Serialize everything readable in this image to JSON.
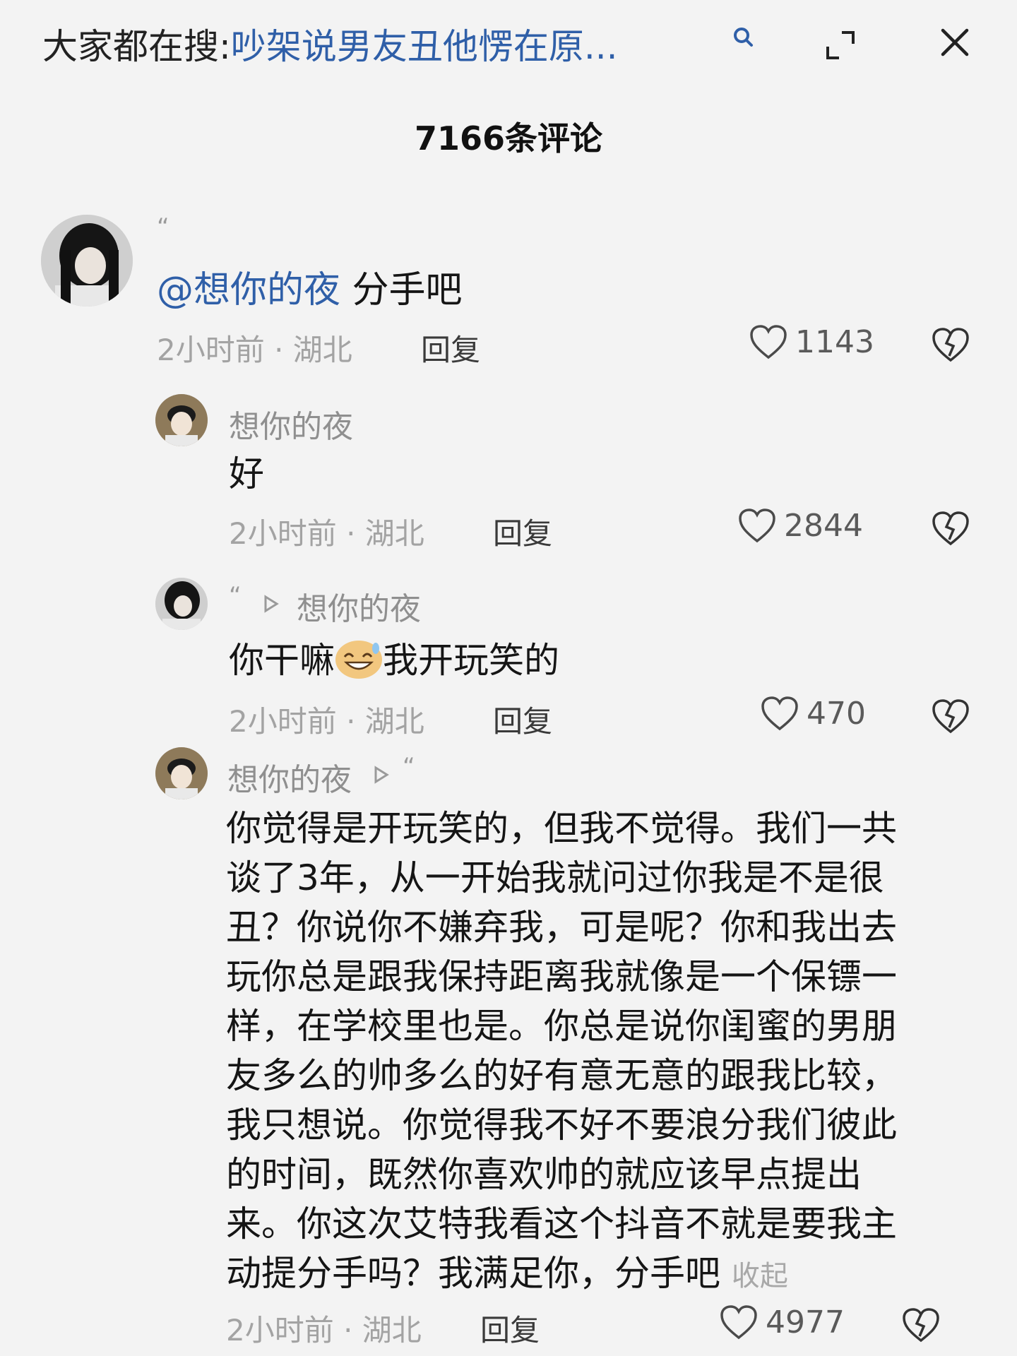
{
  "header": {
    "search_prefix": "大家都在搜:",
    "search_query": "吵架说男友丑他愣在原...",
    "icons": [
      "search-icon",
      "expand-icon",
      "close-icon"
    ]
  },
  "title": "7166条评论",
  "comments": [
    {
      "quote_mark": "“",
      "mention": "@想你的夜",
      "text": " 分手吧",
      "time": "2小时前",
      "location": "湖北",
      "reply_label": "回复",
      "likes": "1143"
    },
    {
      "username": "想你的夜",
      "text": "好",
      "time": "2小时前",
      "location": "湖北",
      "reply_label": "回复",
      "likes": "2844"
    },
    {
      "quote_mark": "“",
      "reply_to": "想你的夜",
      "text_before_emoji": "你干嘛",
      "emoji": "sweat-smile-emoji",
      "text_after_emoji": "我开玩笑的",
      "time": "2小时前",
      "location": "湖北",
      "reply_label": "回复",
      "likes": "470"
    },
    {
      "username": "想你的夜",
      "quote_mark": "“",
      "lines": [
        "你觉得是开玩笑的，但我不觉得。我们一共",
        "谈了3年，从一开始我就问过你我是不是很",
        "丑？你说你不嫌弃我，可是呢？你和我出去",
        "玩你总是跟我保持距离我就像是一个保镖一",
        "样，在学校里也是。你总是说你闺蜜的男朋",
        "友多么的帅多么的好有意无意的跟我比较，",
        "我只想说。你觉得我不好不要浪分我们彼此",
        "的时间，既然你喜欢帅的就应该早点提出",
        "来。你这次艾特我看这个抖音不就是要我主",
        "动提分手吗？我满足你，分手吧"
      ],
      "collapse_label": "收起",
      "time": "2小时前",
      "location": "湖北",
      "reply_label": "回复",
      "likes": "4977"
    }
  ],
  "meta_separator": " · ",
  "colors": {
    "link": "#2f5fa8",
    "background": "#f3f3f3"
  }
}
